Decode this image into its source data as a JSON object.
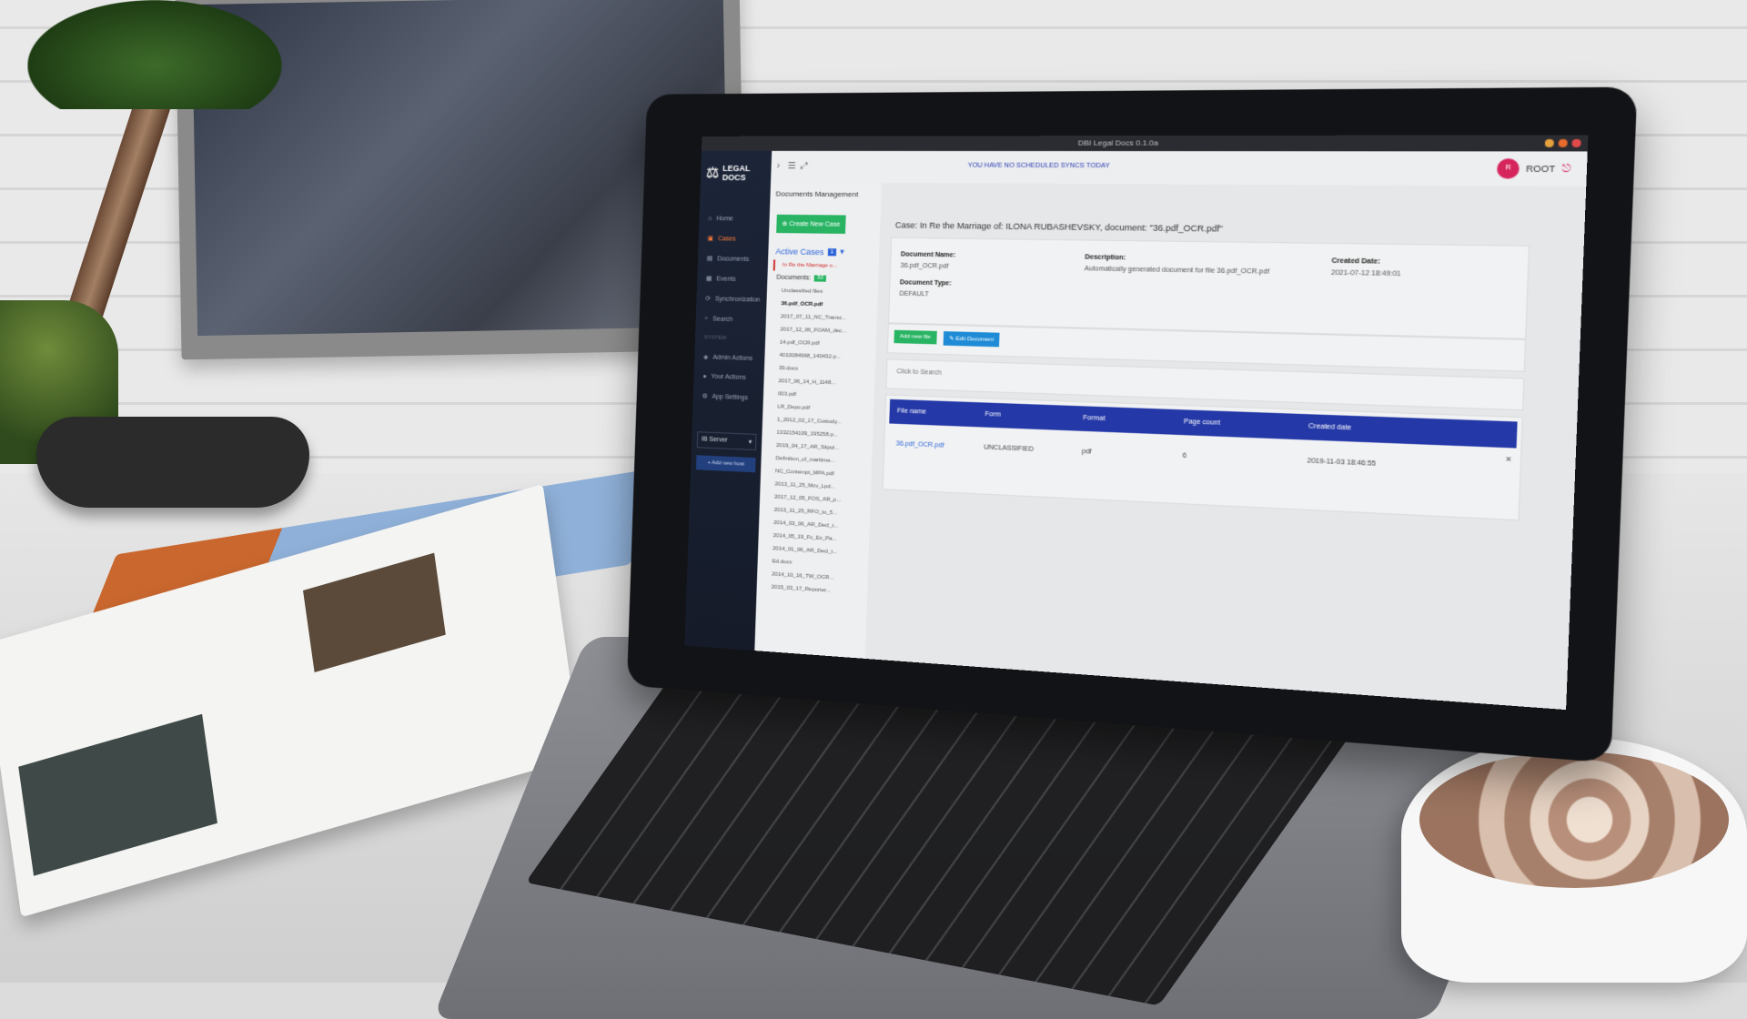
{
  "window": {
    "title": "DBI Legal Docs 0.1.0a",
    "controls": {
      "minimize_color": "#e6a23c",
      "maximize_color": "#e86a2c",
      "close_color": "#e34b4b"
    }
  },
  "app": {
    "logo_line1": "LEGAL",
    "logo_line2": "DOCS",
    "logo_icon": "scales-icon"
  },
  "sidebar": {
    "items": [
      {
        "label": "Home",
        "icon": "home-icon"
      },
      {
        "label": "Cases",
        "icon": "briefcase-icon",
        "active": true
      },
      {
        "label": "Documents",
        "icon": "file-icon"
      },
      {
        "label": "Events",
        "icon": "calendar-icon"
      },
      {
        "label": "Synchronization",
        "icon": "sync-icon"
      },
      {
        "label": "Search",
        "icon": "search-icon"
      }
    ],
    "section_label": "SYSTEM",
    "system_items": [
      {
        "label": "Admin Actions",
        "icon": "shield-icon"
      },
      {
        "label": "Your Actions",
        "icon": "user-icon"
      },
      {
        "label": "App Settings",
        "icon": "gear-icon"
      }
    ],
    "server_select": "IB Server",
    "add_host_label": "+ Add new host"
  },
  "topbar": {
    "sync_message": "YOU HAVE NO SCHEDULED SYNCS TODAY",
    "user_initials": "R",
    "user_name": "ROOT",
    "avatar_color": "#d6245d"
  },
  "documents_panel": {
    "title": "Documents Management",
    "create_button": "Create New Case",
    "active_cases_label": "Active Cases",
    "active_cases_count": "1",
    "selected_case": "In Re the Marriage o...",
    "documents_label": "Documents:",
    "documents_count": "32",
    "files": [
      "Unclassified files",
      "36.pdf_OCR.pdf",
      "2017_07_11_NC_Transc...",
      "2017_12_06_FOAM_dec...",
      "14.pdf_OCR.pdf",
      "4010084968_140432.p...",
      "39.docx",
      "2017_06_14_H_1148...",
      "003.pdf",
      "LR_Depo.pdf",
      "1_2012_02_17_Custody...",
      "1332154109_195258.p...",
      "2019_04_17_AR_Stipul...",
      "Definition_of_maritime...",
      "NC_Contempt_MPA.pdf",
      "2013_11_25_Mcv_Lpd...",
      "2017_12_05_FOS_AR_p...",
      "2013_11_25_RFO_to_5...",
      "2014_03_06_AR_Decl_t...",
      "2014_05_19_Fc_Ex_Pa...",
      "2014_01_06_AR_Decl_t...",
      "Ed.docx",
      "2014_10_16_TW_OCR...",
      "2015_03_17_Reporter..."
    ],
    "selected_file": "36.pdf_OCR.pdf"
  },
  "main": {
    "case_heading": "Case: In Re the Marriage of: ILONA RUBASHEVSKY, document: \"36.pdf_OCR.pdf\"",
    "info": {
      "document_name_label": "Document Name:",
      "document_name": "36.pdf_OCR.pdf",
      "document_type_label": "Document Type:",
      "document_type": "DEFAULT",
      "description_label": "Description:",
      "description": "Automatically generated document for file 36.pdf_OCR.pdf",
      "created_date_label": "Created Date:",
      "created_date": "2021-07-12 18:49:01"
    },
    "add_file_button": "Add new file",
    "edit_document_button": "Edit Document",
    "search_placeholder": "Click to Search",
    "table": {
      "headers": [
        "File name",
        "Form",
        "Format",
        "Page count",
        "Created date"
      ],
      "rows": [
        {
          "file_name": "36.pdf_OCR.pdf",
          "form": "UNCLASSIFIED",
          "format": "pdf",
          "page_count": "6",
          "created_date": "2019-11-03 18:46:55"
        }
      ],
      "close_symbol": "×"
    }
  }
}
